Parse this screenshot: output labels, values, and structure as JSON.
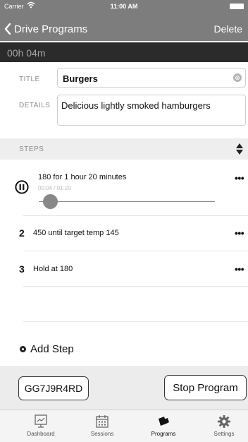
{
  "status_bar": {
    "carrier": "Carrier",
    "time": "11:00 AM"
  },
  "nav": {
    "back_label": "Drive Programs",
    "action_label": "Delete"
  },
  "timer": {
    "elapsed": "00h 04m"
  },
  "form": {
    "title_label": "TITLE",
    "title_value": "Burgers",
    "details_label": "DETAILS",
    "details_value": "Delicious lightly smoked hamburgers"
  },
  "steps": {
    "header": "STEPS",
    "items": [
      {
        "text": "180 for 1 hour 20 minutes",
        "progress_text": "00:04 / 01:20",
        "progress": 0.05
      },
      {
        "number": "2",
        "text": "450 until target temp 145"
      },
      {
        "number": "3",
        "text": "Hold at 180"
      }
    ],
    "add_label": "Add Step"
  },
  "actions": {
    "code": "GG7J9R4RD",
    "stop": "Stop Program"
  },
  "tabs": [
    {
      "label": "Dashboard",
      "icon": "dashboard-icon"
    },
    {
      "label": "Sessions",
      "icon": "calendar-icon"
    },
    {
      "label": "Programs",
      "icon": "programs-icon",
      "active": true
    },
    {
      "label": "Settings",
      "icon": "gear-icon"
    }
  ],
  "icons": {
    "clear": "⊗",
    "more": "•••"
  },
  "colors": {
    "nav_bar": "#7d7d7d",
    "timer_band": "#2b2b2b",
    "accent": "#111111"
  }
}
